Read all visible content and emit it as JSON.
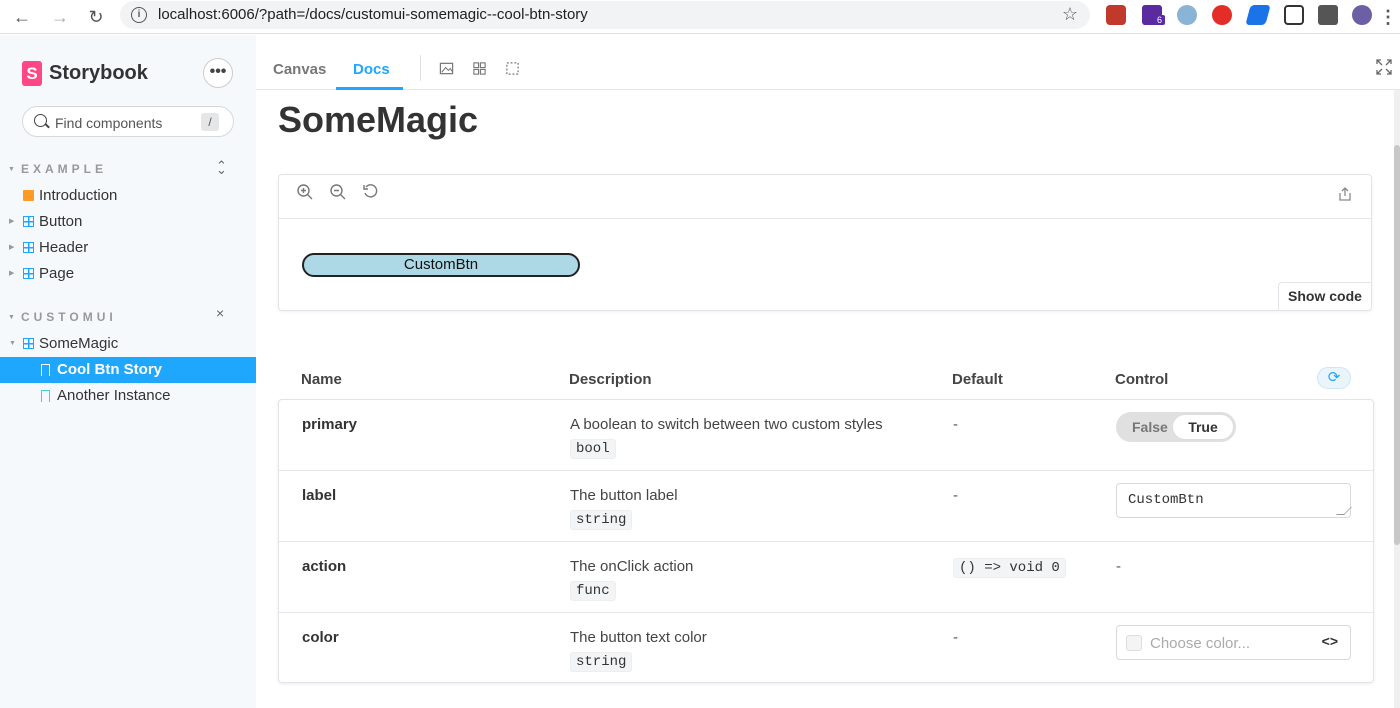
{
  "browser": {
    "url": "localhost:6006/?path=/docs/customui-somemagic--cool-btn-story",
    "ext_badge": "6"
  },
  "sidebar": {
    "logo_text": "Storybook",
    "logo_letter": "S",
    "more_label": "•••",
    "search_placeholder": "Find components",
    "search_shortcut": "/",
    "groups": [
      {
        "title": "EXAMPLE",
        "items": [
          "Introduction",
          "Button",
          "Header",
          "Page"
        ]
      },
      {
        "title": "CUSTOMUI",
        "component": "SomeMagic",
        "stories": [
          "Cool Btn Story",
          "Another Instance"
        ]
      }
    ],
    "selected": "Cool Btn Story"
  },
  "toolbar": {
    "tabs": [
      "Canvas",
      "Docs"
    ],
    "active_tab": "Docs"
  },
  "docs": {
    "title": "SomeMagic",
    "preview_button_label": "CustomBtn",
    "show_code_label": "Show code",
    "columns": [
      "Name",
      "Description",
      "Default",
      "Control"
    ],
    "rows": [
      {
        "name": "primary",
        "description": "A boolean to switch between two custom styles",
        "type": "bool",
        "default": "-",
        "control": {
          "kind": "toggle",
          "off": "False",
          "on": "True",
          "value": true
        }
      },
      {
        "name": "label",
        "description": "The button label",
        "type": "string",
        "default": "-",
        "control": {
          "kind": "text",
          "value": "CustomBtn"
        }
      },
      {
        "name": "action",
        "description": "The onClick action",
        "type": "func",
        "default": "() => void 0",
        "control": {
          "kind": "none",
          "value": "-"
        }
      },
      {
        "name": "color",
        "description": "The button text color",
        "type": "string",
        "default": "-",
        "control": {
          "kind": "color",
          "placeholder": "Choose color...",
          "code_icon": "<>"
        }
      }
    ]
  },
  "colors": {
    "accent": "#1ea7fd",
    "logo": "#ff4785",
    "preview_button_bg": "#add8e6"
  }
}
